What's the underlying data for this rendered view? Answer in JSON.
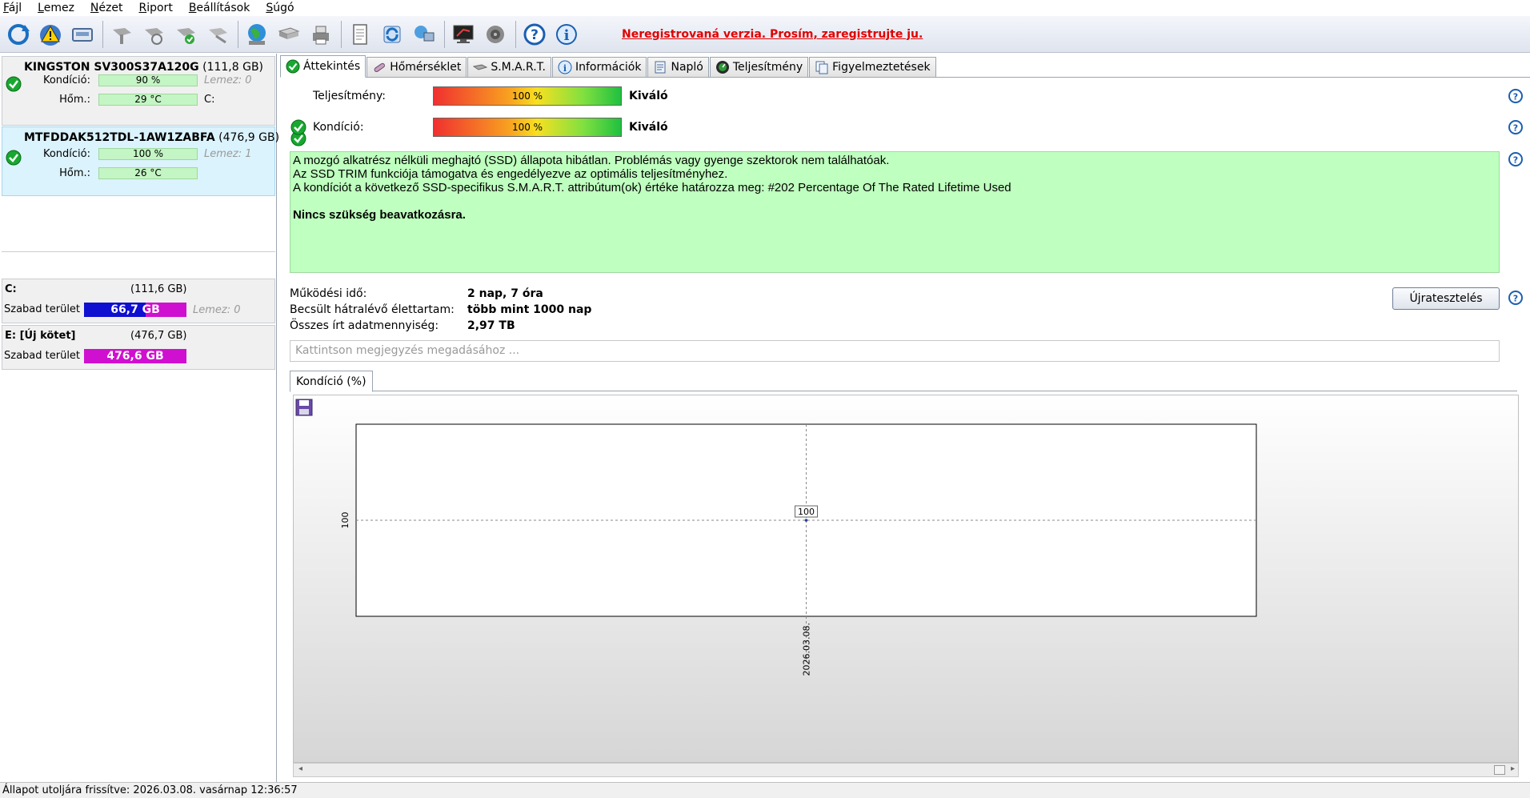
{
  "menu": [
    "Fájl",
    "Lemez",
    "Nézet",
    "Riport",
    "Beállítások",
    "Súgó"
  ],
  "toolbar": {
    "icons": [
      "refresh-icon",
      "warning-icon",
      "disk-icon",
      "tool1-icon",
      "tool2-icon",
      "tool3-icon",
      "tool4-icon",
      "globe-icon",
      "hdd-tool-icon",
      "printer-icon",
      "document-icon",
      "sync-icon",
      "network-icon",
      "monitor-icon",
      "speaker-icon",
      "help-icon",
      "info-icon"
    ],
    "registration": "Neregistrovaná verzia. Prosím, zaregistrujte ju."
  },
  "disks": [
    {
      "model": "KINGSTON SV300S37A120G",
      "size": "(111,8 GB)",
      "condition_label": "Kondíció:",
      "condition": "90 %",
      "condition_pct": 90,
      "temp_label": "Hőm.:",
      "temp": "29 °C",
      "extra1": "Lemez: 0",
      "extra2": "C:",
      "selected": false
    },
    {
      "model": "MTFDDAK512TDL-1AW1ZABFA",
      "size": "(476,9 GB)",
      "condition_label": "Kondíció:",
      "condition": "100 %",
      "condition_pct": 100,
      "temp_label": "Hőm.:",
      "temp": "26 °C",
      "extra1": "Lemez: 1",
      "extra2": "",
      "selected": true
    }
  ],
  "volumes": [
    {
      "name": "C:",
      "size": "(111,6 GB)",
      "free_label": "Szabad terület",
      "free": "66,7 GB",
      "free_color": "#1010d0",
      "extra": "Lemez: 0"
    },
    {
      "name": "E: [Új kötet]",
      "size": "(476,7 GB)",
      "free_label": "Szabad terület",
      "free": "476,6 GB",
      "free_color": "#d010d0",
      "extra": ""
    }
  ],
  "tabs": [
    "Áttekintés",
    "Hőmérséklet",
    "S.M.A.R.T.",
    "Információk",
    "Napló",
    "Teljesítmény",
    "Figyelmeztetések"
  ],
  "overview": {
    "performance": {
      "label": "Teljesítmény:",
      "value": "100 %",
      "pct": 100,
      "rating": "Kiváló"
    },
    "condition": {
      "label": "Kondíció:",
      "value": "100 %",
      "pct": 100,
      "rating": "Kiváló"
    },
    "info_lines": [
      "A mozgó alkatrész nélküli meghajtó (SSD) állapota hibátlan. Problémás vagy gyenge szektorok nem találhatóak.",
      "Az SSD TRIM funkciója támogatva és engedélyezve az optimális teljesítményhez.",
      "A kondíciót a következő SSD-specifikus S.M.A.R.T. attribútum(ok) értéke határozza meg:  #202 Percentage Of The Rated Lifetime Used"
    ],
    "info_action": "Nincs szükség beavatkozásra.",
    "stats": [
      {
        "key": "Működési idő:",
        "value": "2 nap, 7 óra"
      },
      {
        "key": "Becsült hátralévő élettartam:",
        "value": "több mint 1000 nap"
      },
      {
        "key": "Összes írt adatmennyiség:",
        "value": "2,97 TB"
      }
    ],
    "retest_button": "Újratesztelés",
    "note_placeholder": "Kattintson megjegyzés megadásához ..."
  },
  "chart_tab": "Kondíció  (%)",
  "chart_data": {
    "type": "line",
    "x": [
      "2026.03.08."
    ],
    "series": [
      {
        "values": [
          100
        ]
      }
    ],
    "ytick": "100",
    "xtick": "2026.03.08.",
    "data_label": "100"
  },
  "status": "Állapot utoljára frissítve: 2026.03.08. vasárnap 12:36:57"
}
